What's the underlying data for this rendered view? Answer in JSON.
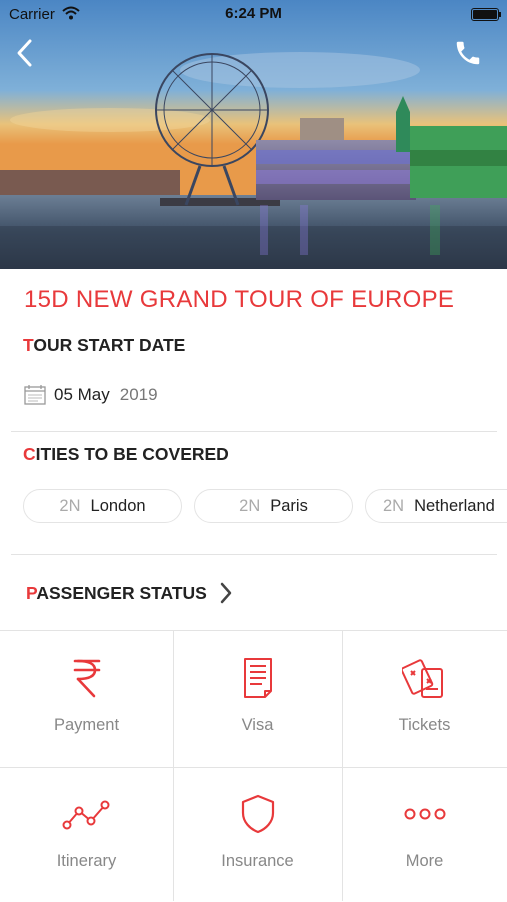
{
  "status_bar": {
    "carrier": "Carrier",
    "time": "6:24 PM"
  },
  "tour": {
    "title": "15D NEW GRAND TOUR OF EUROPE",
    "start_date_heading": {
      "first": "T",
      "rest": "OUR START DATE"
    },
    "start_date": {
      "day_month": "05 May",
      "year": "2019"
    },
    "cities_heading": {
      "first": "C",
      "rest": "ITIES TO BE COVERED"
    },
    "cities": [
      {
        "nights": "2N",
        "name": "London"
      },
      {
        "nights": "2N",
        "name": "Paris"
      },
      {
        "nights": "2N",
        "name": "Netherland"
      }
    ],
    "passenger_heading": {
      "first": "P",
      "rest": "ASSENGER STATUS"
    }
  },
  "actions": [
    {
      "label": "Payment",
      "icon": "rupee-icon"
    },
    {
      "label": "Visa",
      "icon": "document-icon"
    },
    {
      "label": "Tickets",
      "icon": "tickets-icon"
    },
    {
      "label": "Itinerary",
      "icon": "route-icon"
    },
    {
      "label": "Insurance",
      "icon": "shield-icon"
    },
    {
      "label": "More",
      "icon": "more-icon"
    }
  ],
  "colors": {
    "accent": "#e8393b",
    "divider": "#e3e3e3",
    "muted": "#888888"
  }
}
